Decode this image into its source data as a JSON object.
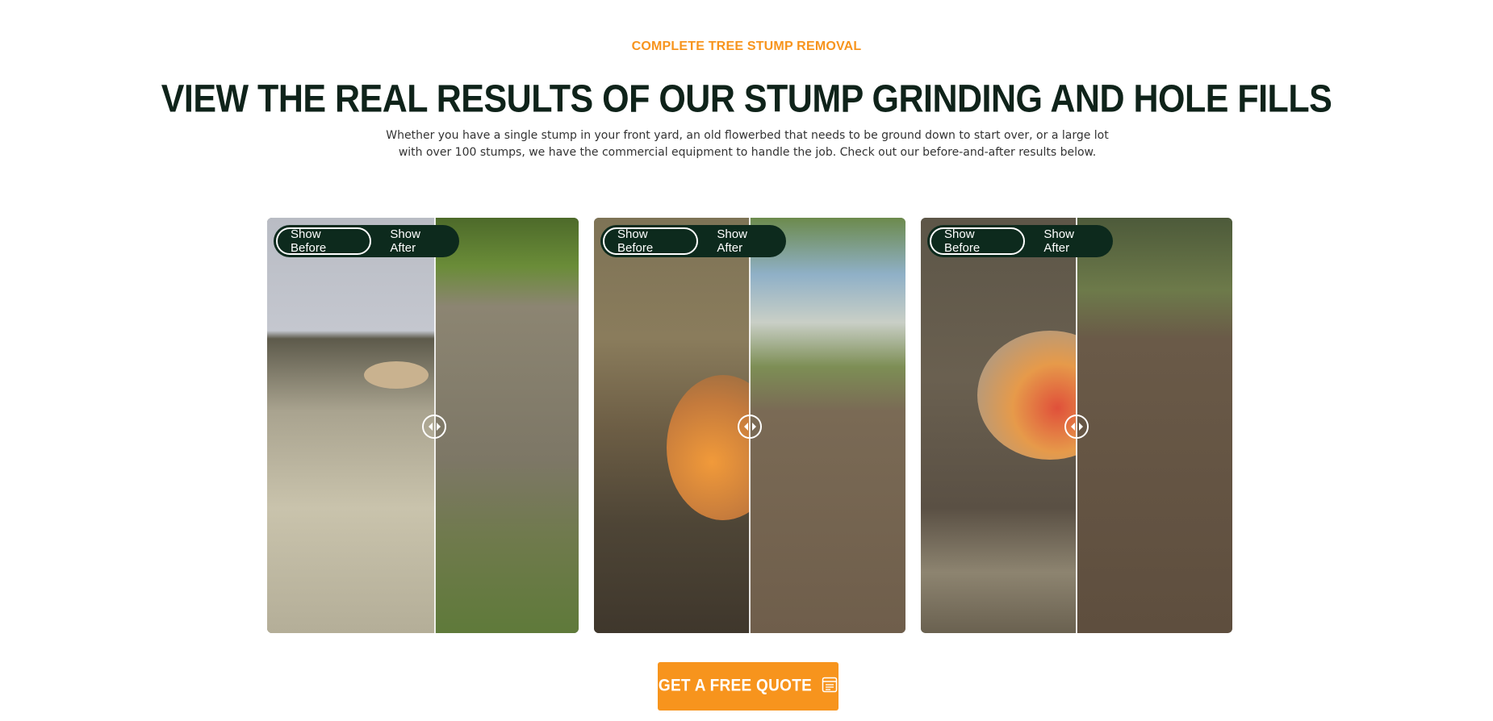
{
  "section": {
    "eyebrow": "COMPLETE TREE STUMP REMOVAL",
    "headline": "VIEW THE REAL RESULTS OF OUR STUMP GRINDING AND HOLE FILLS",
    "intro": "Whether you have a single stump in your front yard, an old flowerbed that needs to be ground down to start over, or a large lot with over 100 stumps, we have the commercial equipment to handle the job. Check out our before-and-after results below."
  },
  "sliders": [
    {
      "show_before": "Show Before",
      "show_after": "Show After"
    },
    {
      "show_before": "Show Before",
      "show_after": "Show After"
    },
    {
      "show_before": "Show Before",
      "show_after": "Show After"
    }
  ],
  "cta": {
    "label": "GET A FREE QUOTE",
    "icon": "quote-form-icon"
  },
  "colors": {
    "accent": "#f7941d",
    "dark_green": "#0d2a1d",
    "heading": "#0f231a"
  }
}
